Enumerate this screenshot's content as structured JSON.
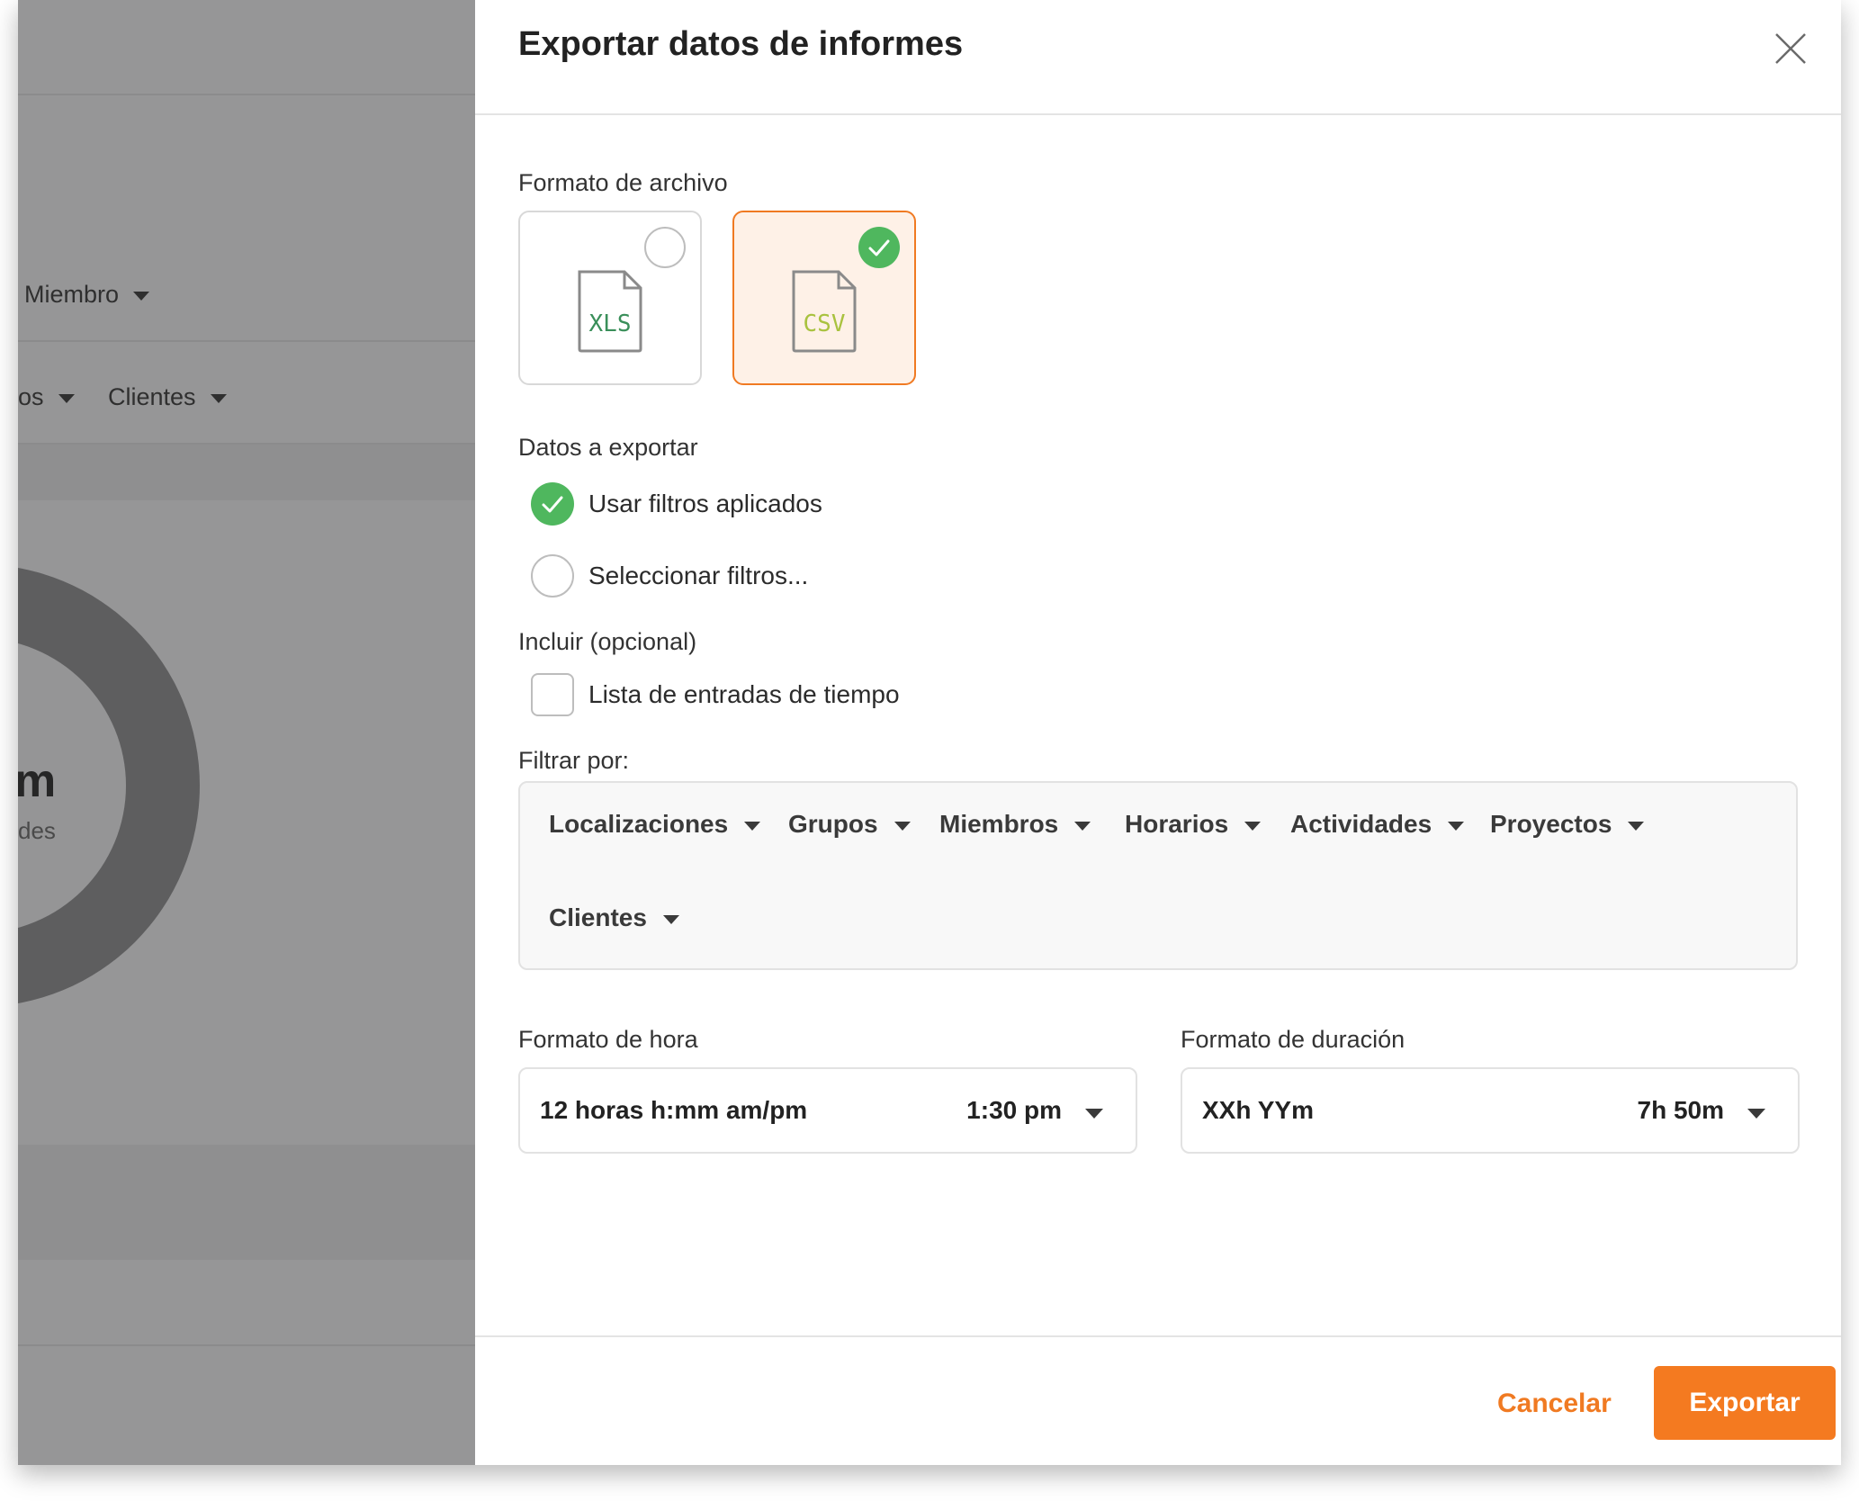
{
  "background": {
    "member_filter_label": "Miembro",
    "partial_filter_label": "os",
    "clients_filter_label": "Clientes",
    "summary_value": "m",
    "summary_caption": "des"
  },
  "modal": {
    "title": "Exportar datos de informes",
    "file_format": {
      "label": "Formato de archivo",
      "options": [
        {
          "label": "XLS",
          "icon": "xls-file-icon",
          "selected": false,
          "color": "#3a8f5a"
        },
        {
          "label": "CSV",
          "icon": "csv-file-icon",
          "selected": true,
          "color": "#a9c23f"
        }
      ]
    },
    "data_to_export": {
      "label": "Datos a exportar",
      "options": [
        {
          "label": "Usar filtros aplicados",
          "selected": true
        },
        {
          "label": "Seleccionar filtros...",
          "selected": false
        }
      ]
    },
    "include": {
      "label": "Incluir (opcional)",
      "options": [
        {
          "label": "Lista de entradas de tiempo",
          "checked": false
        }
      ]
    },
    "filter_by": {
      "label": "Filtrar por:",
      "chips": [
        "Localizaciones",
        "Grupos",
        "Miembros",
        "Horarios",
        "Actividades",
        "Proyectos",
        "Clientes"
      ]
    },
    "time_format": {
      "label": "Formato de hora",
      "value": "12 horas h:mm am/pm",
      "example": "1:30 pm"
    },
    "duration_format": {
      "label": "Formato de duración",
      "value": "XXh YYm",
      "example": "7h 50m"
    },
    "buttons": {
      "cancel": "Cancelar",
      "export": "Exportar"
    }
  },
  "colors": {
    "accent": "#f47a20",
    "success": "#4fb75e",
    "overlay": "#969697"
  }
}
